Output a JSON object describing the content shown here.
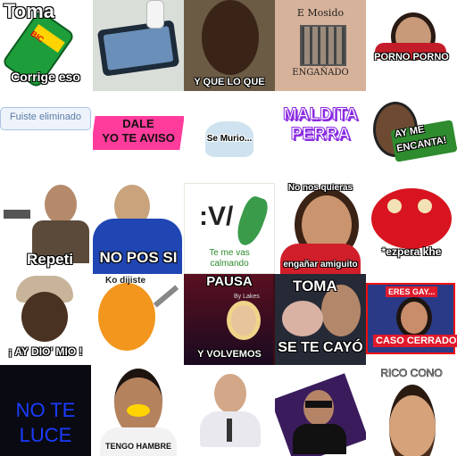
{
  "stickers": {
    "r1": {
      "toma": "Toma",
      "corrige": "Corrige eso",
      "bic": "BIC",
      "que": "Y QUE LO QUE",
      "mosido": "E Mosido",
      "enganado": "ENGAÑADO",
      "porno": "PORNO PORNO"
    },
    "r2": {
      "eliminado": "Fuiste eliminado",
      "dale": "DALE",
      "aviso": "YO TE AVISO",
      "murio": "Se Murio...",
      "maldita": "MALDITA",
      "perra": "PERRA",
      "encanta1": "AY ME",
      "encanta2": "ENCANTA!"
    },
    "r3": {
      "repeti": "Repeti",
      "nopos": "NO POS SI",
      "v": ":V/",
      "calmando1": "Te me vas",
      "calmando2": "calmando",
      "quieras": "No nos quieras",
      "amiguito": "engañar amiguito",
      "ezpera": "*ezpera khe"
    },
    "r4": {
      "aydio": "¡ AY DIO' MIO !",
      "dijiste": "Ko dijiste",
      "pausa": "PAUSA",
      "lakes": "By Lakes",
      "volvemos": "Y VOLVEMOS",
      "toma2": "TOMA",
      "secayo": "SE TE CAYÓ",
      "eresgay": "ERES GAY...",
      "caso": "CASO CERRADO"
    },
    "r5": {
      "note1": "NO TE",
      "note2": "LUCE",
      "hambre": "TENGO HAMBRE",
      "rico": "RICO CONO"
    }
  },
  "colors": {
    "blue_text": "#1a3cff",
    "purple": "#8a2be2",
    "green_badge": "#2e8b2e",
    "red_badge": "#e0192b",
    "pink": "#ff3c9c"
  }
}
